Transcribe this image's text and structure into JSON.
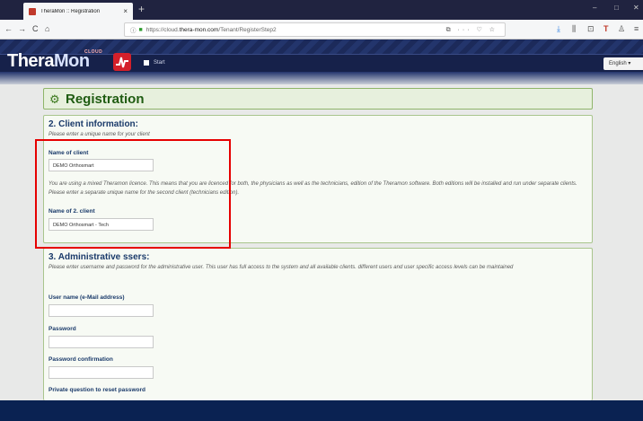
{
  "browser": {
    "tab_title": "TheraMon :: Registration",
    "tab_close": "×",
    "new_tab": "+",
    "win_min": "–",
    "win_max": "□",
    "win_close": "✕",
    "nav_back": "←",
    "nav_forward": "→",
    "nav_reload": "C",
    "nav_home": "⌂",
    "url_prefix": "https://cloud.",
    "url_host": "thera-mon.com",
    "url_path": "/Tenant/RegisterStep2",
    "url_icons": "⧉ ··· ♡ ☆",
    "toolbar_icons": [
      "⤓",
      "⫼",
      "⊡",
      "T",
      "♙",
      "≡"
    ]
  },
  "site": {
    "logo_thera": "Thera",
    "logo_mon": "Mon",
    "logo_cloud": "CLOUD",
    "nav_start": "Start",
    "language": "English ▾"
  },
  "page": {
    "title": "Registration",
    "gears_icon": "⚙"
  },
  "client_section": {
    "heading": "2. Client information:",
    "subtitle": "Please enter a unique name for your client",
    "name_label": "Name of client",
    "name_value": "DEMO Orthosmart",
    "info_text": "You are using a mixed Theramon licence. This means that you are licenced for both, the physicians as well as the technicians, edition of the Theramon software. Both editions will be installed and run under separate clients. Please enter a separate unique name for the second client (technicians edition).",
    "name2_label": "Name of 2. client",
    "name2_value": "DEMO Orthosmart - Tech"
  },
  "admin_section": {
    "heading": "3. Administrative ssers:",
    "subtitle": "Please enter username and password for the administrative user. This user has full access to the system and all available clients. different users and user specific access levels can be maintained",
    "username_label": "User name (e-Mail address)",
    "username_value": "",
    "password_label": "Password",
    "password_value": "",
    "password_confirm_label": "Password confirmation",
    "password_confirm_value": "",
    "private_question_label": "Private question to reset password"
  },
  "colors": {
    "highlight": "#e60000",
    "header_navy": "#1c2a5a",
    "accent_green": "#1f5c12"
  }
}
